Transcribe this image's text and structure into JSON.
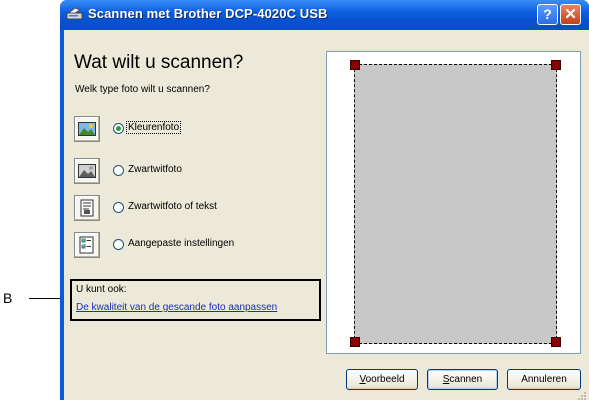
{
  "window": {
    "title": "Scannen met Brother DCP-4020C USB",
    "help_glyph": "?",
    "close_glyph": "✕"
  },
  "main": {
    "heading": "Wat wilt u scannen?",
    "subheading": "Welk type foto wilt u scannen?"
  },
  "options": [
    {
      "label": "Kleurenfoto",
      "icon": "color-photo-icon",
      "selected": true
    },
    {
      "label": "Zwartwitfoto",
      "icon": "grayscale-photo-icon",
      "selected": false
    },
    {
      "label": "Zwartwitfoto of tekst",
      "icon": "text-document-icon",
      "selected": false
    },
    {
      "label": "Aangepaste instellingen",
      "icon": "custom-settings-icon",
      "selected": false
    }
  ],
  "also": {
    "label": "U kunt ook:",
    "link": "De kwaliteit van de gescande foto aanpassen"
  },
  "buttons": {
    "preview": "Voorbeeld",
    "scan": "Scannen",
    "cancel": "Annuleren"
  },
  "annotation": {
    "label": "B"
  },
  "colors": {
    "titlebar": "#0750cf",
    "dialog_bg": "#ece9d8",
    "link": "#1a2fb8",
    "scan_area": "#c8c8c8",
    "handle": "#8a0000"
  }
}
